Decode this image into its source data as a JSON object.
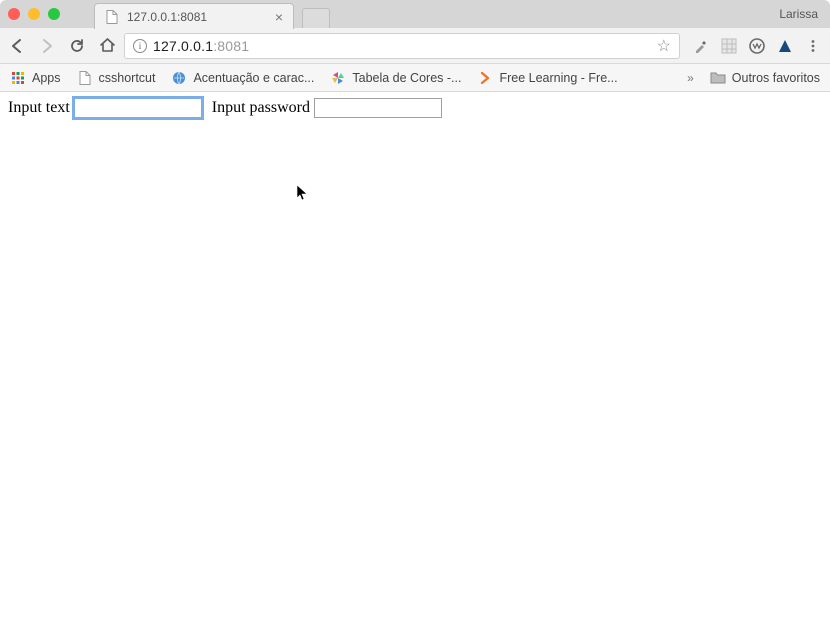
{
  "window": {
    "profile_name": "Larissa",
    "tab_title": "127.0.0.1:8081",
    "url_host": "127.0.0.1",
    "url_port": ":8081"
  },
  "bookmarks": {
    "apps_label": "Apps",
    "items": [
      {
        "label": "csshortcut"
      },
      {
        "label": "Acentuação e carac..."
      },
      {
        "label": "Tabela de Cores -..."
      },
      {
        "label": "Free Learning - Fre..."
      }
    ],
    "overflow_label": "»",
    "other_label": "Outros favoritos"
  },
  "page": {
    "text_label": "Input text",
    "password_label": "Input password",
    "text_value": "",
    "password_value": ""
  }
}
